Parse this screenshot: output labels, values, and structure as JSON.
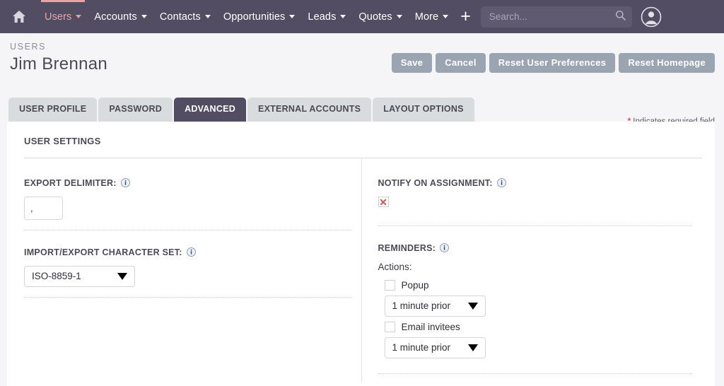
{
  "navbar": {
    "home_icon": "home-icon",
    "items": [
      {
        "label": "Users",
        "active": true,
        "has_caret": true
      },
      {
        "label": "Accounts",
        "active": false,
        "has_caret": true
      },
      {
        "label": "Contacts",
        "active": false,
        "has_caret": true
      },
      {
        "label": "Opportunities",
        "active": false,
        "has_caret": true
      },
      {
        "label": "Leads",
        "active": false,
        "has_caret": true
      },
      {
        "label": "Quotes",
        "active": false,
        "has_caret": true
      },
      {
        "label": "More",
        "active": false,
        "has_caret": true
      }
    ],
    "plus_label": "+",
    "search": {
      "value": "",
      "placeholder": "Search...",
      "icon": "search-icon"
    },
    "avatar_icon": "user-avatar-icon",
    "bg_color": "#534d64",
    "active_accent": "#e9a3a1"
  },
  "header": {
    "module": "USERS",
    "record_name": "Jim Brennan",
    "buttons": [
      {
        "label": "Save",
        "name": "save-button"
      },
      {
        "label": "Cancel",
        "name": "cancel-button"
      },
      {
        "label": "Reset User Preferences",
        "name": "reset-user-preferences-button"
      },
      {
        "label": "Reset Homepage",
        "name": "reset-homepage-button"
      }
    ],
    "required_star": "*",
    "required_text": "Indicates required field",
    "button_color": "#9ba5b1",
    "required_star_color": "#cc5352"
  },
  "tabs": [
    {
      "label": "USER PROFILE",
      "active": false
    },
    {
      "label": "PASSWORD",
      "active": false
    },
    {
      "label": "ADVANCED",
      "active": true
    },
    {
      "label": "EXTERNAL ACCOUNTS",
      "active": false
    },
    {
      "label": "LAYOUT OPTIONS",
      "active": false
    }
  ],
  "panel": {
    "title": "USER SETTINGS",
    "left": {
      "export_delimiter": {
        "label": "EXPORT DELIMITER:",
        "info_icon": "info-icon",
        "value": ","
      },
      "charset": {
        "label": "IMPORT/EXPORT CHARACTER SET:",
        "info_icon": "info-icon",
        "selected": "ISO-8859-1"
      }
    },
    "right": {
      "notify_on_assignment": {
        "label": "NOTIFY ON ASSIGNMENT:",
        "info_icon": "info-icon",
        "checked_glyph": "✕",
        "checked": true
      },
      "reminders": {
        "label": "REMINDERS:",
        "info_icon": "info-icon",
        "actions_label": "Actions:",
        "popup": {
          "label": "Popup",
          "checked": false,
          "timing": "1 minute prior"
        },
        "email_invitees": {
          "label": "Email invitees",
          "checked": false,
          "timing": "1 minute prior"
        }
      }
    }
  }
}
